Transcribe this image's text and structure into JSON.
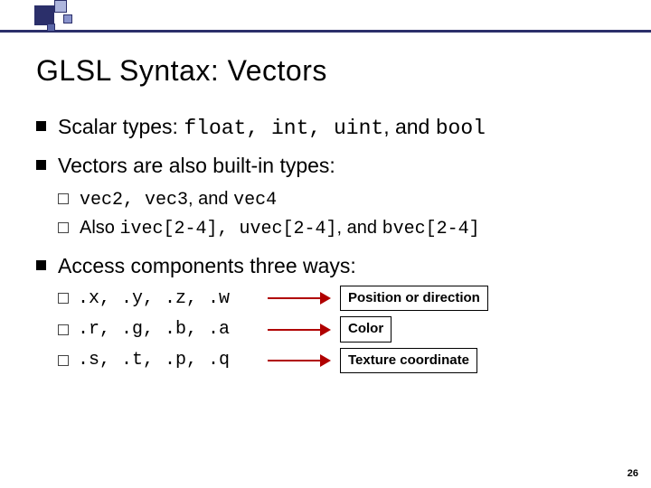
{
  "title": "GLSL Syntax:  Vectors",
  "bullets": {
    "b1_pre": "Scalar types:  ",
    "b1_code": "float, int, uint",
    "b1_mid": ", and ",
    "b1_code2": "bool",
    "b2": "Vectors are also built-in types:",
    "b2a_code": "vec2, vec3",
    "b2a_mid": ", and ",
    "b2a_code2": "vec4",
    "b2b_pre": "Also ",
    "b2b_code": "ivec[2-4], uvec[2-4]",
    "b2b_mid": ", and ",
    "b2b_code2": "bvec[2-4]",
    "b3": "Access components three ways:"
  },
  "access": [
    {
      "combo": ".x, .y, .z, .w",
      "label": "Position or direction"
    },
    {
      "combo": ".r, .g, .b, .a",
      "label": "Color"
    },
    {
      "combo": ".s, .t, .p, .q",
      "label": "Texture coordinate"
    }
  ],
  "page": "26"
}
